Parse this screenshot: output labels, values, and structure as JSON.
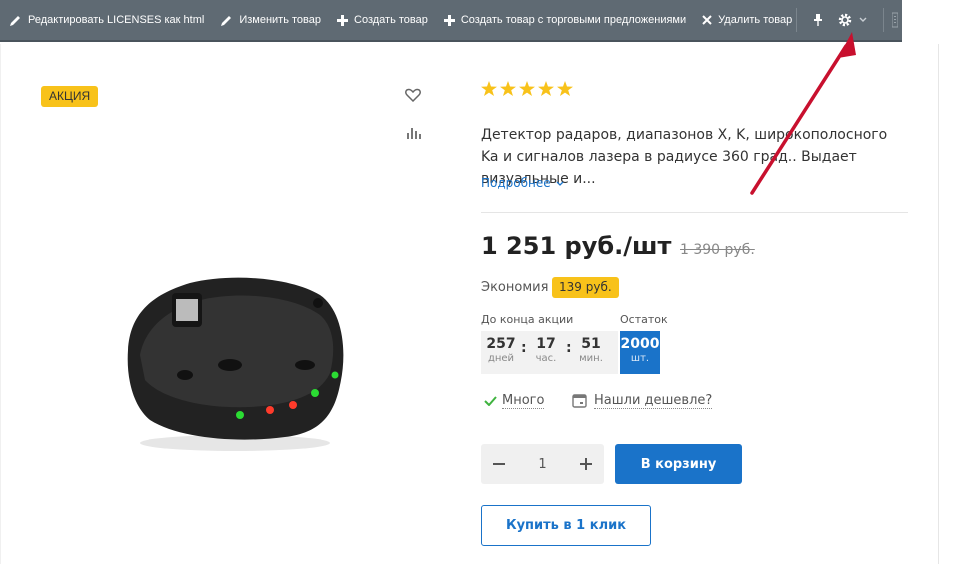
{
  "toolbar": {
    "edit_licenses": "Редактировать LICENSES как html",
    "edit_product": "Изменить товар",
    "create_product": "Создать товар",
    "create_with_offers": "Создать товар с торговыми предложениями",
    "delete_product": "Удалить товар"
  },
  "product": {
    "badge": "АКЦИЯ",
    "rating_stars": 5,
    "description": "Детектор радаров, диапазонов X, K, широкополосного Ka и сигналов лазера в радиусе 360 град.. Выдает визуальные и...",
    "more_link": "Подробнее",
    "price": "1 251 руб./шт",
    "old_price": "1 390 руб.",
    "economy_label": "Экономия",
    "economy_value": "139 руб.",
    "timer_label": "До конца акции",
    "stock_label": "Остаток",
    "timer": {
      "days": "257",
      "days_unit": "дней",
      "hours": "17",
      "hours_unit": "час.",
      "minutes": "51",
      "minutes_unit": "мин."
    },
    "stock": {
      "value": "2000",
      "unit": "шт."
    },
    "availability": "Много",
    "found_cheaper": "Нашли дешевле?",
    "quantity": "1",
    "add_to_cart": "В корзину",
    "buy_one_click": "Купить в 1 клик"
  },
  "colors": {
    "accent": "#1a73c9",
    "badge": "#f8c21a",
    "star": "#f8c21a",
    "toolbar": "#5f6a73",
    "arrow": "#c8102e"
  }
}
